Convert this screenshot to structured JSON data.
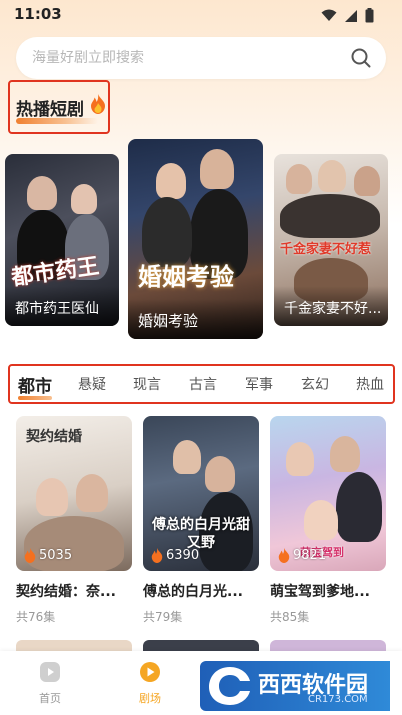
{
  "status_bar": {
    "time": "11:03"
  },
  "search": {
    "placeholder": "海量好剧立即搜索"
  },
  "hot_section": {
    "title": "热播短剧"
  },
  "hot_dramas": [
    {
      "title": "都市药王医仙",
      "poster_text": "都市药王"
    },
    {
      "title": "婚姻考验",
      "poster_text": "婚姻考验"
    },
    {
      "title": "千金家妻不好...",
      "poster_text": "千金家妻不好惹"
    }
  ],
  "category_tabs": [
    "都市",
    "悬疑",
    "现言",
    "古言",
    "军事",
    "玄幻",
    "热血"
  ],
  "active_tab": "都市",
  "dramas": [
    {
      "title": "契约结婚：奈...",
      "views": "5035",
      "episodes": "共76集",
      "poster_text": "契约结婚"
    },
    {
      "title": "傅总的白月光...",
      "views": "6390",
      "episodes": "共79集",
      "poster_text": "傅总的白月光甜又野"
    },
    {
      "title": "萌宝驾到爹地...",
      "views": "9821",
      "episodes": "共85集",
      "poster_text": "萌宝驾到"
    }
  ],
  "bottom_nav": [
    {
      "label": "首页",
      "icon": "play-square-icon",
      "active": false
    },
    {
      "label": "剧场",
      "icon": "theater-play-icon",
      "active": true
    }
  ],
  "watermark": {
    "brand": "西西软件园",
    "url": "CR173.COM"
  },
  "colors": {
    "accent": "#f08030",
    "highlight_box": "#e0341f",
    "active_nav": "#f5a623"
  }
}
